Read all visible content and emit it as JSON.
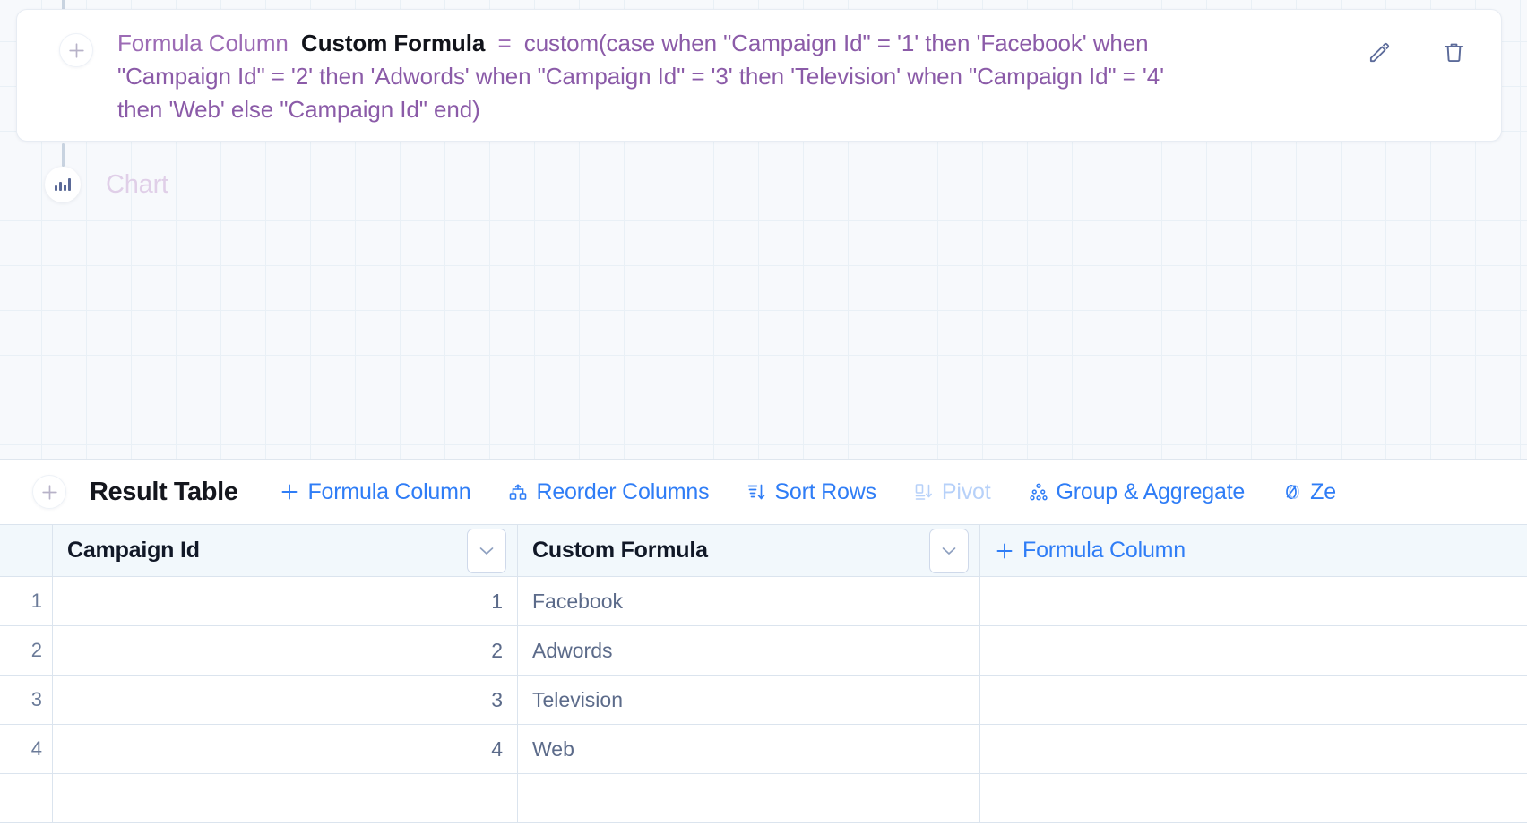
{
  "formula_card": {
    "add_icon": "plus-icon",
    "label": "Formula Column",
    "name": "Custom Formula",
    "equals": "=",
    "expression": "custom(case when \"Campaign Id\" = '1' then 'Facebook' when \"Campaign Id\" = '2' then 'Adwords' when \"Campaign Id\" = '3' then 'Television' when \"Campaign Id\" = '4' then 'Web' else \"Campaign Id\" end)",
    "edit_icon": "pencil-icon",
    "delete_icon": "trash-icon",
    "text_color": "#8b5ba8"
  },
  "chart_node": {
    "icon": "bar-chart-icon",
    "label": "Chart",
    "label_color": "#e0cfe8"
  },
  "result_table": {
    "add_icon": "plus-icon",
    "title": "Result Table",
    "actions": [
      {
        "label": "Formula Column",
        "icon": "plus-icon",
        "disabled": false
      },
      {
        "label": "Reorder Columns",
        "icon": "reorder-columns-icon",
        "disabled": false
      },
      {
        "label": "Sort Rows",
        "icon": "sort-rows-icon",
        "disabled": false
      },
      {
        "label": "Pivot",
        "icon": "pivot-icon",
        "disabled": true
      },
      {
        "label": "Group & Aggregate",
        "icon": "group-aggregate-icon",
        "disabled": false
      },
      {
        "label": "Ze",
        "icon": "zero-fill-icon",
        "disabled": false
      }
    ],
    "accent_color": "#2f7df6",
    "disabled_color": "#b7d1f9",
    "columns": [
      {
        "header": "Campaign Id",
        "caret": "chevron-down-icon"
      },
      {
        "header": "Custom Formula",
        "caret": "chevron-down-icon"
      }
    ],
    "add_column_label": "Formula Column",
    "add_column_icon": "plus-icon",
    "rows": [
      {
        "num": "1",
        "campaign_id": "1",
        "custom_formula": "Facebook"
      },
      {
        "num": "2",
        "campaign_id": "2",
        "custom_formula": "Adwords"
      },
      {
        "num": "3",
        "campaign_id": "3",
        "custom_formula": "Television"
      },
      {
        "num": "4",
        "campaign_id": "4",
        "custom_formula": "Web"
      }
    ]
  }
}
